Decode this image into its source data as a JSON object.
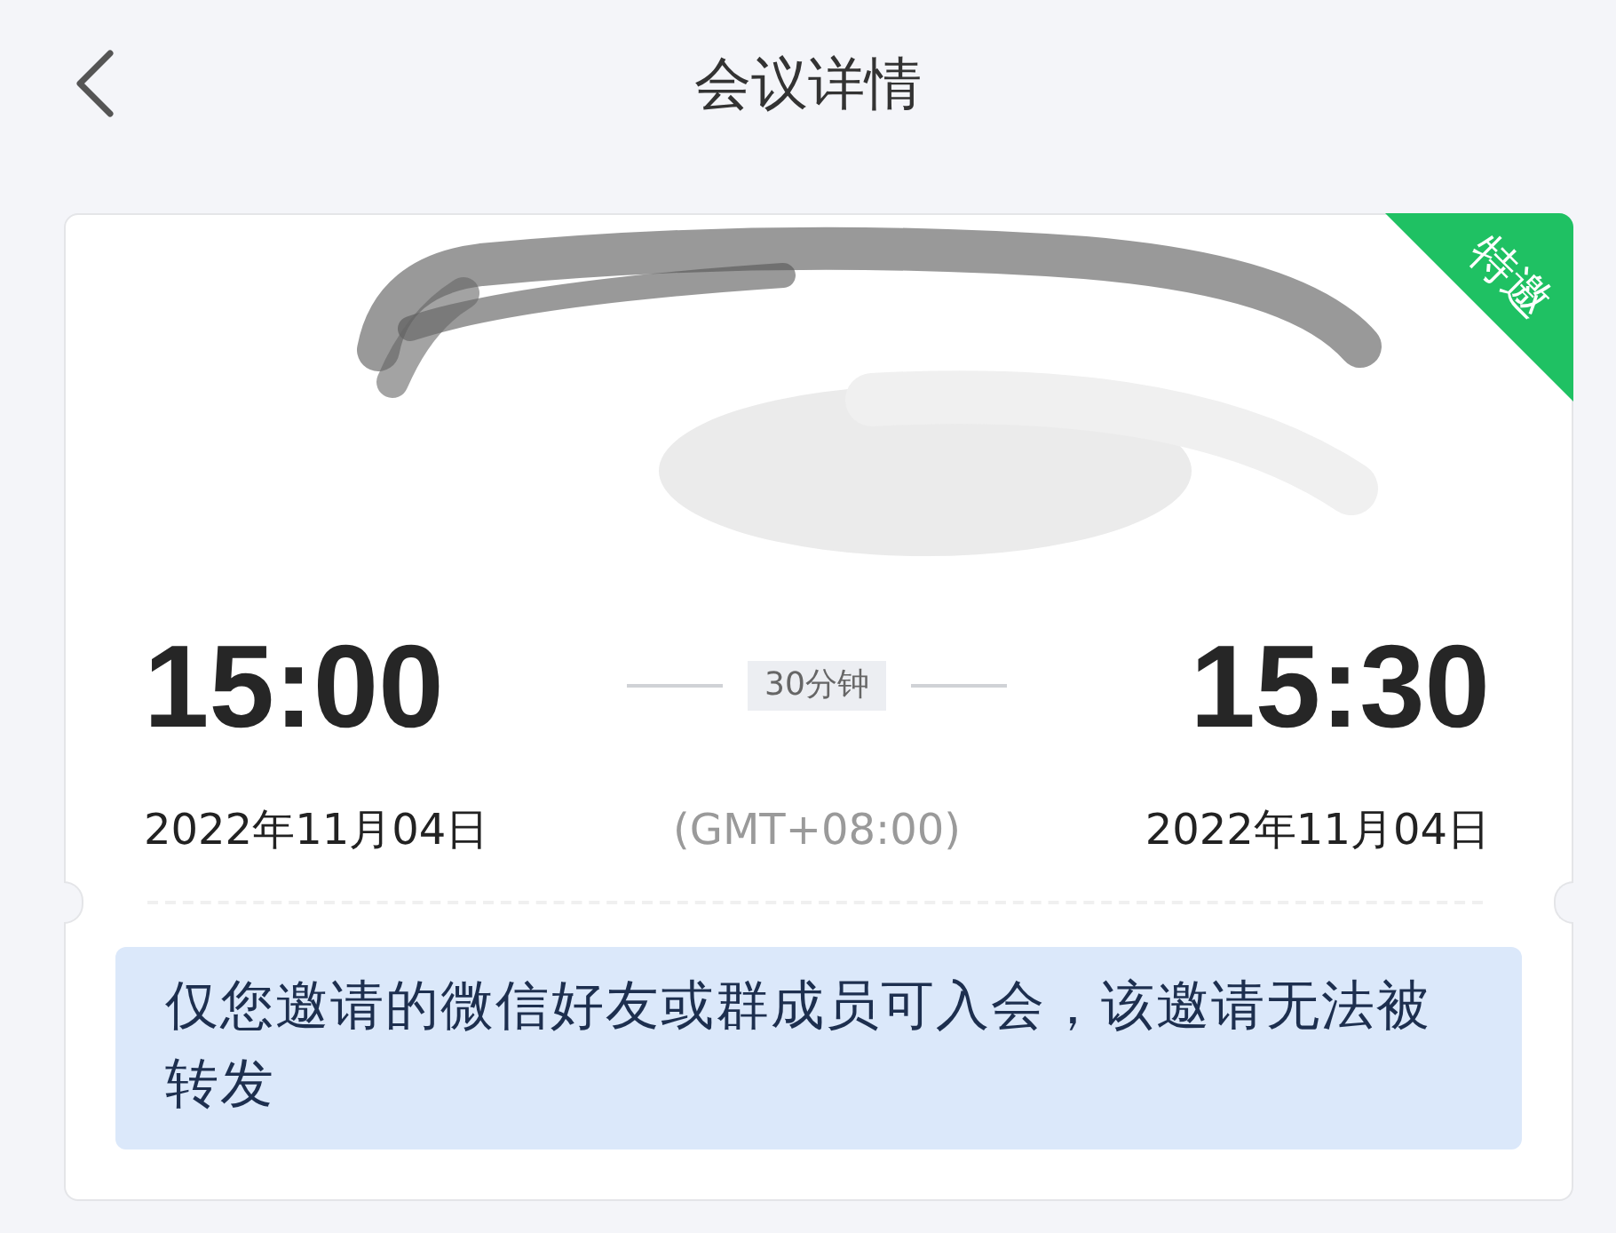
{
  "header": {
    "title": "会议详情"
  },
  "card": {
    "ribbon": "特邀",
    "start": {
      "time": "15:00",
      "date": "2022年11月04日"
    },
    "duration": "30分钟",
    "timezone": "(GMT+08:00)",
    "end": {
      "time": "15:30",
      "date": "2022年11月04日"
    },
    "notice": "仅您邀请的微信好友或群成员可入会，该邀请无法被转发"
  }
}
